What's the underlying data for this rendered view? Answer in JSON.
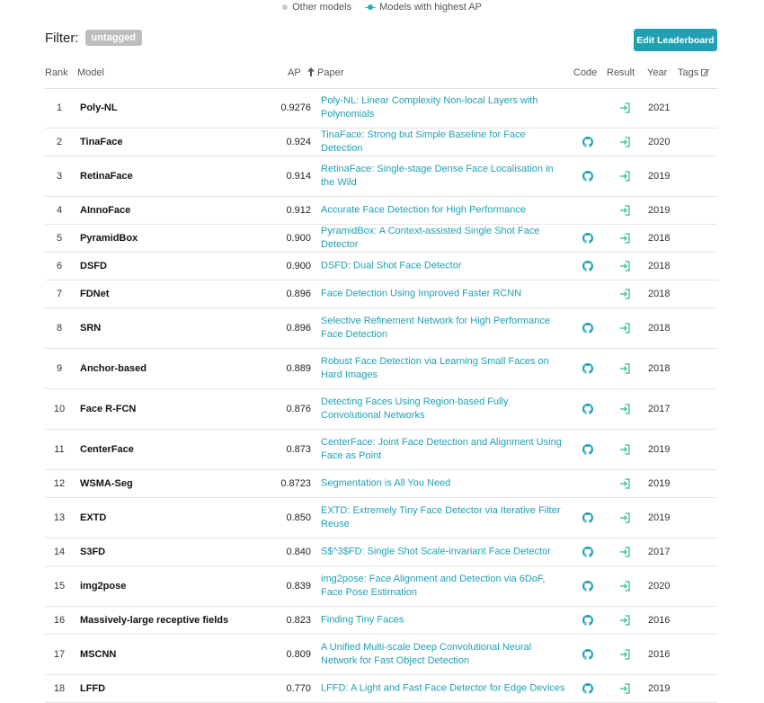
{
  "legend": {
    "other": "Other models",
    "highest": "Models with highest AP"
  },
  "filter": {
    "label": "Filter:",
    "tag": "untagged"
  },
  "edit_button": "Edit Leaderboard",
  "headers": {
    "rank": "Rank",
    "model": "Model",
    "ap": "AP",
    "paper": "Paper",
    "code": "Code",
    "result": "Result",
    "year": "Year",
    "tags": "Tags"
  },
  "colors": {
    "accent": "#21a0b3",
    "result_icon": "#2bbf7f",
    "tag_chip": "#bdbdbd"
  },
  "icons": {
    "sort": "sort-arrow-up-icon",
    "tags_edit": "edit-icon",
    "code": "github-icon",
    "result": "result-link-icon"
  },
  "rows": [
    {
      "rank": "1",
      "model": "Poly-NL",
      "ap": "0.9276",
      "paper": "Poly-NL: Linear Complexity Non-local Layers with Polynomials",
      "code": false,
      "year": "2021"
    },
    {
      "rank": "2",
      "model": "TinaFace",
      "ap": "0.924",
      "paper": "TinaFace: Strong but Simple Baseline for Face Detection",
      "code": true,
      "year": "2020"
    },
    {
      "rank": "3",
      "model": "RetinaFace",
      "ap": "0.914",
      "paper": "RetinaFace: Single-stage Dense Face Localisation in the Wild",
      "code": true,
      "year": "2019"
    },
    {
      "rank": "4",
      "model": "AInnoFace",
      "ap": "0.912",
      "paper": "Accurate Face Detection for High Performance",
      "code": false,
      "year": "2019"
    },
    {
      "rank": "5",
      "model": "PyramidBox",
      "ap": "0.900",
      "paper": "PyramidBox: A Context-assisted Single Shot Face Detector",
      "code": true,
      "year": "2018"
    },
    {
      "rank": "6",
      "model": "DSFD",
      "ap": "0.900",
      "paper": "DSFD: Dual Shot Face Detector",
      "code": true,
      "year": "2018"
    },
    {
      "rank": "7",
      "model": "FDNet",
      "ap": "0.896",
      "paper": "Face Detection Using Improved Faster RCNN",
      "code": false,
      "year": "2018"
    },
    {
      "rank": "8",
      "model": "SRN",
      "ap": "0.896",
      "paper": "Selective Refinement Network for High Performance Face Detection",
      "code": true,
      "year": "2018"
    },
    {
      "rank": "9",
      "model": "Anchor-based",
      "ap": "0.889",
      "paper": "Robust Face Detection via Learning Small Faces on Hard Images",
      "code": true,
      "year": "2018"
    },
    {
      "rank": "10",
      "model": "Face R-FCN",
      "ap": "0.876",
      "paper": "Detecting Faces Using Region-based Fully Convolutional Networks",
      "code": true,
      "year": "2017"
    },
    {
      "rank": "11",
      "model": "CenterFace",
      "ap": "0.873",
      "paper": "CenterFace: Joint Face Detection and Alignment Using Face as Point",
      "code": true,
      "year": "2019"
    },
    {
      "rank": "12",
      "model": "WSMA-Seg",
      "ap": "0.8723",
      "paper": "Segmentation is All You Need",
      "code": false,
      "year": "2019"
    },
    {
      "rank": "13",
      "model": "EXTD",
      "ap": "0.850",
      "paper": "EXTD: Extremely Tiny Face Detector via Iterative Filter Reuse",
      "code": true,
      "year": "2019"
    },
    {
      "rank": "14",
      "model": "S3FD",
      "ap": "0.840",
      "paper": "S$^3$FD: Single Shot Scale-invariant Face Detector",
      "code": true,
      "year": "2017"
    },
    {
      "rank": "15",
      "model": "img2pose",
      "ap": "0.839",
      "paper": "img2pose: Face Alignment and Detection via 6DoF, Face Pose Estimation",
      "code": true,
      "year": "2020"
    },
    {
      "rank": "16",
      "model": "Massively-large receptive fields",
      "ap": "0.823",
      "paper": "Finding Tiny Faces",
      "code": true,
      "year": "2016"
    },
    {
      "rank": "17",
      "model": "MSCNN",
      "ap": "0.809",
      "paper": "A Unified Multi-scale Deep Convolutional Neural Network for Fast Object Detection",
      "code": true,
      "year": "2016"
    },
    {
      "rank": "18",
      "model": "LFFD",
      "ap": "0.770",
      "paper": "LFFD: A Light and Fast Face Detector for Edge Devices",
      "code": true,
      "year": "2019"
    }
  ]
}
